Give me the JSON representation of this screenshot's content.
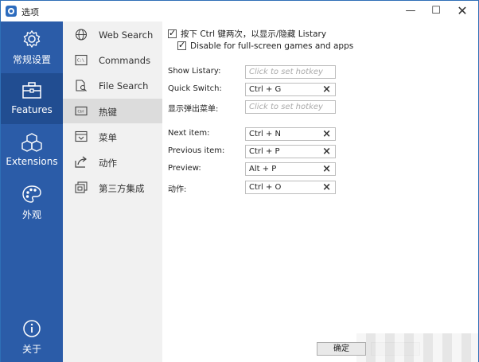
{
  "window": {
    "title": "选项"
  },
  "sidebar": {
    "items": [
      {
        "label": "常规设置",
        "icon": "gear-icon"
      },
      {
        "label": "Features",
        "icon": "toolbox-icon",
        "active": true
      },
      {
        "label": "Extensions",
        "icon": "cubes-icon"
      },
      {
        "label": "外观",
        "icon": "palette-icon"
      }
    ],
    "about": {
      "label": "关于",
      "icon": "info-icon"
    }
  },
  "nav": {
    "items": [
      {
        "label": "Web Search",
        "icon": "globe-icon"
      },
      {
        "label": "Commands",
        "icon": "terminal-icon"
      },
      {
        "label": "File Search",
        "icon": "file-search-icon"
      },
      {
        "label": "热键",
        "icon": "keyboard-icon",
        "active": true
      },
      {
        "label": "菜单",
        "icon": "menu-icon"
      },
      {
        "label": "动作",
        "icon": "action-icon"
      },
      {
        "label": "第三方集成",
        "icon": "integration-icon"
      }
    ]
  },
  "options": {
    "ctrl_toggle": {
      "label": "按下 Ctrl 键两次，以显示/隐藏 Listary",
      "checked": true
    },
    "fullscreen_disable": {
      "label": "Disable for full-screen games and apps",
      "checked": true
    }
  },
  "hotkeys": {
    "placeholder": "Click to set hotkey",
    "show_listary": {
      "label": "Show Listary:",
      "value": ""
    },
    "quick_switch": {
      "label": "Quick Switch:",
      "value": "Ctrl + G"
    },
    "popup_menu": {
      "label": "显示弹出菜单:",
      "value": ""
    },
    "next_item": {
      "label": "Next item:",
      "value": "Ctrl + N"
    },
    "previous_item": {
      "label": "Previous item:",
      "value": "Ctrl + P"
    },
    "preview": {
      "label": "Preview:",
      "value": "Alt + P"
    },
    "action": {
      "label": "动作:",
      "value": "Ctrl + O"
    },
    "clear_symbol": "×"
  },
  "footer": {
    "ok_label": "确定"
  },
  "colors": {
    "sidebar": "#2b5ca8",
    "sidebar_active": "#214d91",
    "nav_bg": "#f1f1f1",
    "nav_active": "#dcdcdc"
  }
}
